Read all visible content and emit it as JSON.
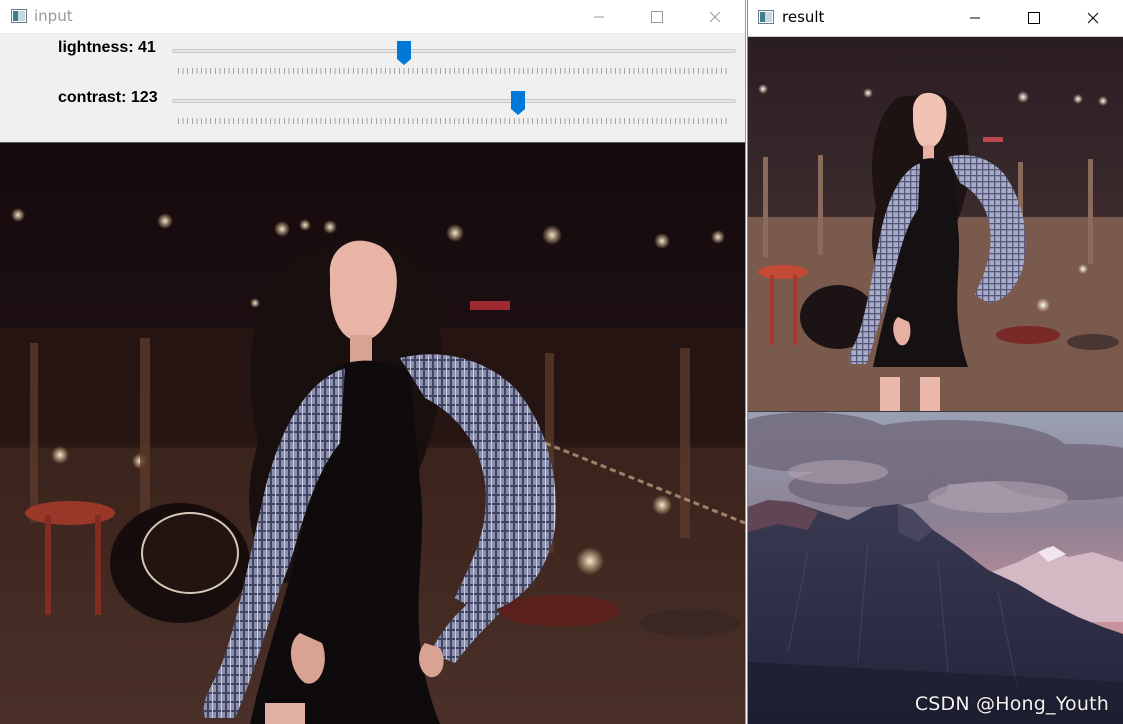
{
  "windows": {
    "input": {
      "title": "input",
      "trackbars": [
        {
          "label": "lightness: 41",
          "value": 41,
          "max": 100
        },
        {
          "label": "contrast: 123",
          "value": 123,
          "max": 200
        }
      ]
    },
    "result": {
      "title": "result",
      "watermark": "CSDN @Hong_Youth"
    }
  },
  "colors": {
    "accent": "#0078d7",
    "night_sky": "#160b0d",
    "mountain_dark": "#2a2c3f",
    "sky_pink": "#c98d9a"
  },
  "icons": {
    "app": "opencv-window-icon",
    "minimize": "minimize-icon",
    "maximize": "maximize-icon",
    "close": "close-icon"
  }
}
